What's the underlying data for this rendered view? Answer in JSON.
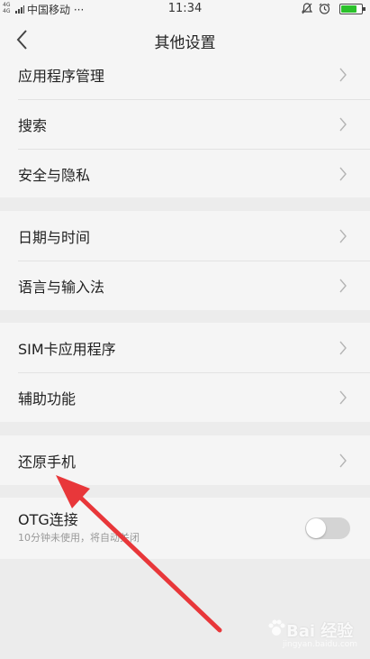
{
  "status_bar": {
    "network_tag_top": "4G",
    "network_tag_bottom": "4G",
    "carrier": "中国移动 ···",
    "time": "11:34",
    "icons": [
      "signal-icon",
      "mute-icon",
      "alarm-icon",
      "battery-charging-icon"
    ],
    "battery_color": "#2bc12b"
  },
  "nav": {
    "title": "其他设置",
    "back_icon": "chevron-left-icon"
  },
  "groups": [
    {
      "items": [
        {
          "label": "应用程序管理"
        },
        {
          "label": "搜索"
        },
        {
          "label": "安全与隐私"
        }
      ]
    },
    {
      "items": [
        {
          "label": "日期与时间"
        },
        {
          "label": "语言与输入法"
        }
      ]
    },
    {
      "items": [
        {
          "label": "SIM卡应用程序"
        },
        {
          "label": "辅助功能"
        }
      ]
    },
    {
      "items": [
        {
          "label": "还原手机"
        }
      ]
    }
  ],
  "otg": {
    "label": "OTG连接",
    "subtitle": "10分钟未使用，将自动关闭",
    "enabled": false
  },
  "annotation": {
    "arrow_color": "#e8373a"
  },
  "watermark": {
    "text": "Bai 经验",
    "sub": "jingyan.baidu.com"
  },
  "colors": {
    "background": "#ececec",
    "row_background": "#f5f5f5",
    "chevron": "#b4b4b4"
  }
}
